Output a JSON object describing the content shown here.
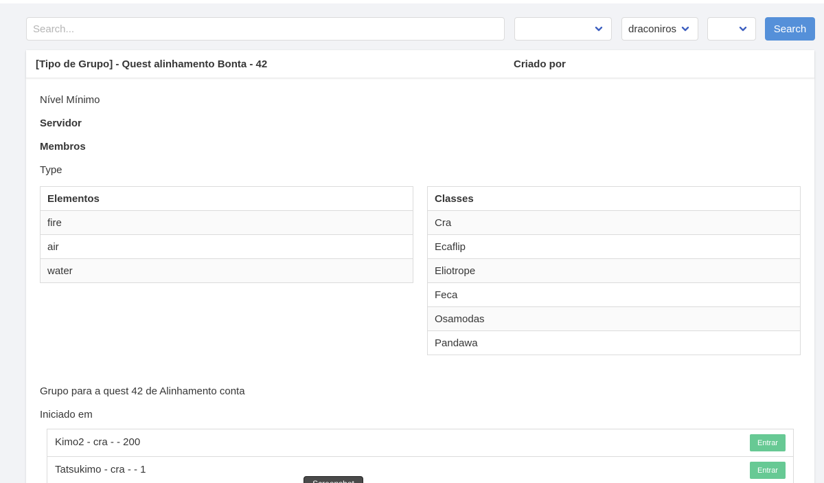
{
  "search": {
    "placeholder": "Search...",
    "value": "",
    "button_label": "Search"
  },
  "filters": [
    {
      "value": ""
    },
    {
      "value": "draconiros"
    },
    {
      "value": ""
    }
  ],
  "card": {
    "title": "[Tipo de Grupo] - Quest alinhamento Bonta - 42",
    "created_by_label": "Criado por",
    "nivel_minimo_label": "Nível Mínimo",
    "servidor_label": "Servidor",
    "membros_label": "Membros",
    "type_label": "Type",
    "description": "Grupo para a quest 42 de Alinhamento conta",
    "iniciado_label": "Iniciado em"
  },
  "elements_table": {
    "header": "Elementos",
    "rows": [
      "fire",
      "air",
      "water"
    ]
  },
  "classes_table": {
    "header": "Classes",
    "rows": [
      "Cra",
      "Ecaflip",
      "Eliotrope",
      "Feca",
      "Osamodas",
      "Pandawa"
    ]
  },
  "members": [
    {
      "label": "Kimo2 - cra - - 200",
      "action": "Entrar"
    },
    {
      "label": "Tatsukimo - cra - - 1",
      "action": "Entrar"
    }
  ],
  "tooltip": {
    "text": "Screenshot"
  },
  "colors": {
    "primary": "#5590d9",
    "success": "#67c994",
    "chevron": "#3e60c0"
  }
}
